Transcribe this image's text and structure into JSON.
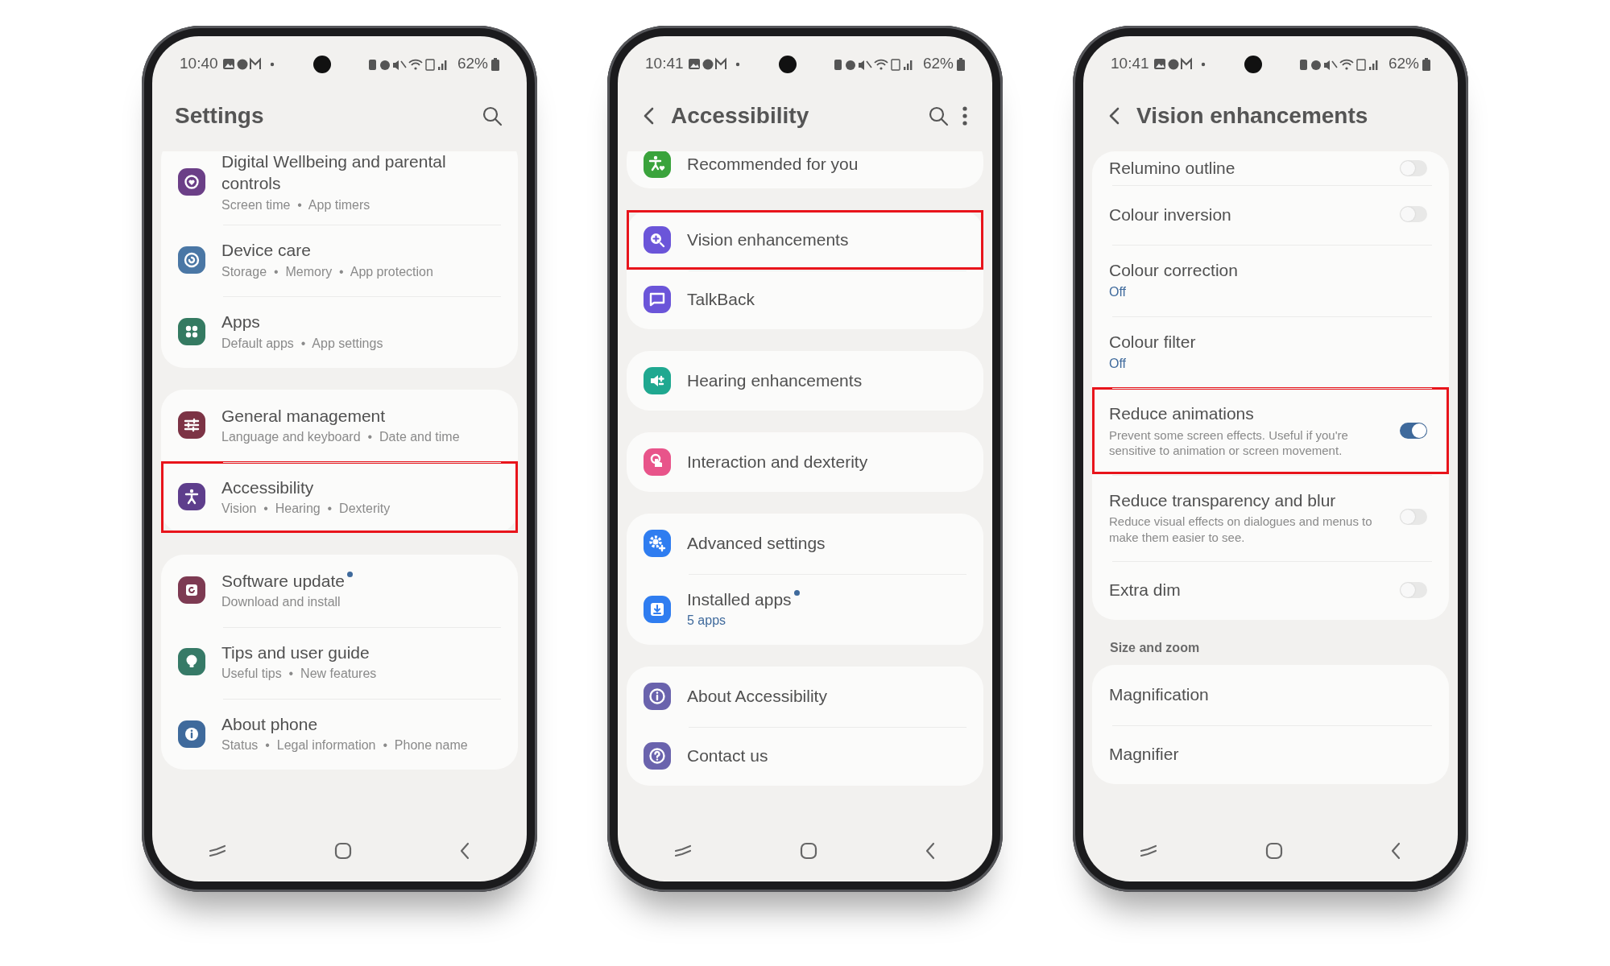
{
  "phones": [
    {
      "status_bar": {
        "time": "10:40",
        "battery": "62%"
      },
      "header": {
        "title": "Settings",
        "back": false,
        "search": true,
        "more": false
      },
      "groups": [
        {
          "items": [
            {
              "kind": "nav",
              "title": "Digital Wellbeing and parental controls",
              "subtitle": "Screen time  •  App timers",
              "color": "#6b3f87",
              "new": false,
              "highlighted": false
            },
            {
              "kind": "nav",
              "title": "Device care",
              "subtitle": "Storage  •  Memory  •  App protection",
              "color": "#4a77a5",
              "new": false,
              "highlighted": false
            },
            {
              "kind": "nav",
              "title": "Apps",
              "subtitle": "Default apps  •  App settings",
              "color": "#347a61",
              "new": false,
              "highlighted": false
            }
          ]
        },
        {
          "items": [
            {
              "kind": "nav",
              "title": "General management",
              "subtitle": "Language and keyboard  •  Date and time",
              "color": "#7c3345",
              "new": false,
              "highlighted": false
            },
            {
              "kind": "nav",
              "title": "Accessibility",
              "subtitle": "Vision  •  Hearing  •  Dexterity",
              "color": "#5e3e8c",
              "new": false,
              "highlighted": true
            }
          ]
        },
        {
          "items": [
            {
              "kind": "nav",
              "title": "Software update",
              "subtitle": "Download and install",
              "color": "#7d3a52",
              "new": true,
              "highlighted": false
            },
            {
              "kind": "nav",
              "title": "Tips and user guide",
              "subtitle": "Useful tips  •  New features",
              "color": "#367a67",
              "new": false,
              "highlighted": false
            },
            {
              "kind": "nav",
              "title": "About phone",
              "subtitle": "Status  •  Legal information  •  Phone name",
              "color": "#3f6a9c",
              "new": false,
              "highlighted": false
            }
          ]
        }
      ]
    },
    {
      "status_bar": {
        "time": "10:41",
        "battery": "62%"
      },
      "header": {
        "title": "Accessibility",
        "back": true,
        "search": true,
        "more": true
      },
      "groups": [
        {
          "items": [
            {
              "kind": "nav",
              "title": "Recommended for you",
              "color": "#3aa33c",
              "new": false,
              "highlighted": false
            }
          ]
        },
        {
          "items": [
            {
              "kind": "nav",
              "title": "Vision enhancements",
              "color": "#6b55d9",
              "new": false,
              "highlighted": true
            },
            {
              "kind": "nav",
              "title": "TalkBack",
              "color": "#6b55d9",
              "new": false,
              "highlighted": false
            }
          ]
        },
        {
          "items": [
            {
              "kind": "nav",
              "title": "Hearing enhancements",
              "color": "#1fa890",
              "new": false,
              "highlighted": false
            }
          ]
        },
        {
          "items": [
            {
              "kind": "nav",
              "title": "Interaction and dexterity",
              "color": "#e8548a",
              "new": false,
              "highlighted": false
            }
          ]
        },
        {
          "items": [
            {
              "kind": "nav",
              "title": "Advanced settings",
              "color": "#2f7df0",
              "new": false,
              "highlighted": false
            },
            {
              "kind": "status",
              "title": "Installed apps",
              "subtitle": "5 apps",
              "color": "#2f7df0",
              "new": true,
              "highlighted": false
            }
          ]
        },
        {
          "items": [
            {
              "kind": "nav",
              "title": "About Accessibility",
              "color": "#6a63ad",
              "new": false,
              "highlighted": false
            },
            {
              "kind": "nav",
              "title": "Contact us",
              "color": "#6a63ad",
              "new": false,
              "highlighted": false
            }
          ]
        }
      ]
    },
    {
      "status_bar": {
        "time": "10:41",
        "battery": "62%"
      },
      "header": {
        "title": "Vision enhancements",
        "back": true,
        "search": false,
        "more": false
      },
      "groups": [
        {
          "items": [
            {
              "kind": "toggle",
              "title": "Relumino outline",
              "on": false,
              "new": false,
              "highlighted": false
            },
            {
              "kind": "toggle",
              "title": "Colour inversion",
              "on": false,
              "new": false,
              "highlighted": false
            },
            {
              "kind": "status",
              "title": "Colour correction",
              "subtitle": "Off",
              "new": false,
              "highlighted": false
            },
            {
              "kind": "status",
              "title": "Colour filter",
              "subtitle": "Off",
              "new": false,
              "highlighted": false
            },
            {
              "kind": "toggle",
              "title": "Reduce animations",
              "subtitle": "Prevent some screen effects. Useful if you're sensitive to animation or screen movement.",
              "on": true,
              "new": false,
              "highlighted": true
            },
            {
              "kind": "toggle",
              "title": "Reduce transparency and blur",
              "subtitle": "Reduce visual effects on dialogues and menus to make them easier to see.",
              "on": false,
              "new": false,
              "highlighted": false
            },
            {
              "kind": "toggle",
              "title": "Extra dim",
              "on": false,
              "new": false,
              "highlighted": false
            }
          ]
        },
        {
          "header": "Size and zoom",
          "items": [
            {
              "kind": "nav",
              "title": "Magnification",
              "new": false,
              "highlighted": false
            },
            {
              "kind": "nav",
              "title": "Magnifier",
              "new": false,
              "highlighted": false
            }
          ]
        }
      ]
    }
  ]
}
